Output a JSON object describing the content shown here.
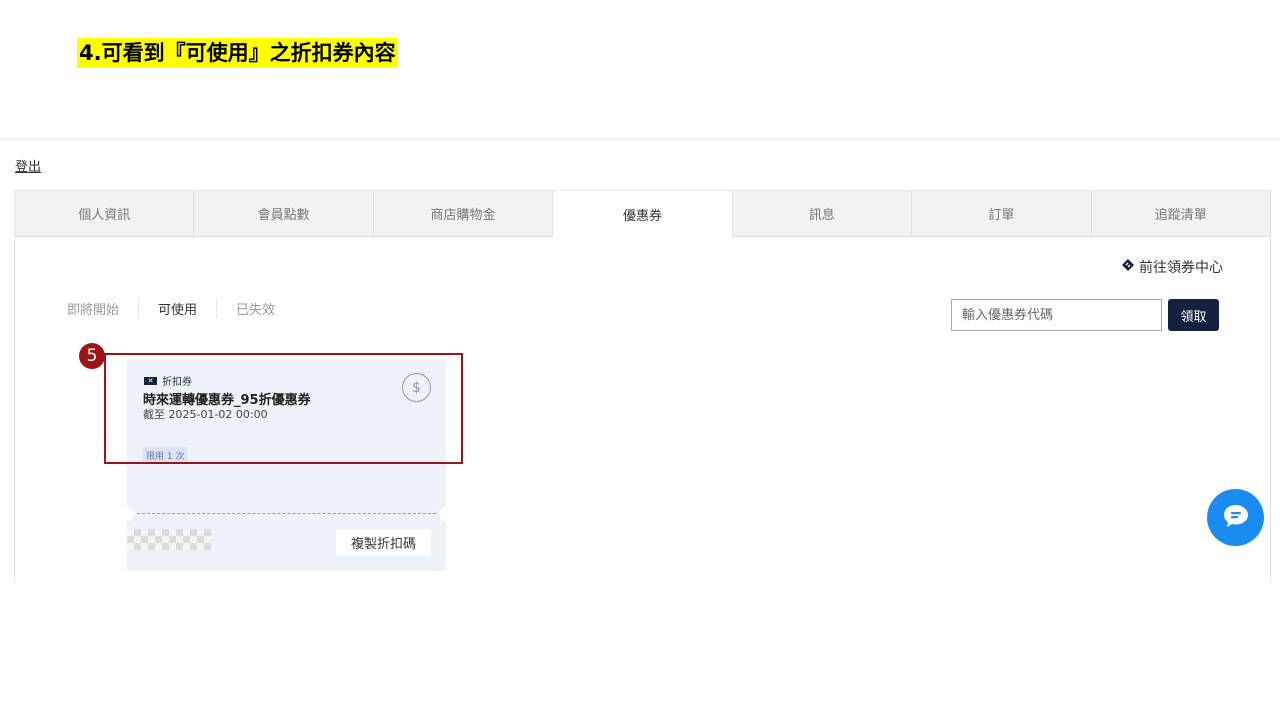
{
  "caption": "4.可看到『可使用』之折扣券內容",
  "logout": "登出",
  "tabs": [
    "個人資訊",
    "會員點數",
    "商店購物金",
    "優惠券",
    "訊息",
    "訂單",
    "追蹤清單"
  ],
  "goto_center": "前往領券中心",
  "subtabs": [
    "即將開始",
    "可使用",
    "已失效"
  ],
  "code_placeholder": "輸入優惠券代碼",
  "claim_label": "領取",
  "coupon": {
    "type": "折扣券",
    "name": "時來運轉優惠券_95折優惠券",
    "expiry": "截至 2025-01-02 00:00",
    "limit": "限用 1 次",
    "copy_label": "複製折扣碼",
    "currency_symbol": "$"
  },
  "step_badge": "5",
  "colors": {
    "highlight": "#9b1515",
    "primary": "#14203d",
    "chat": "#1a8cf0"
  }
}
